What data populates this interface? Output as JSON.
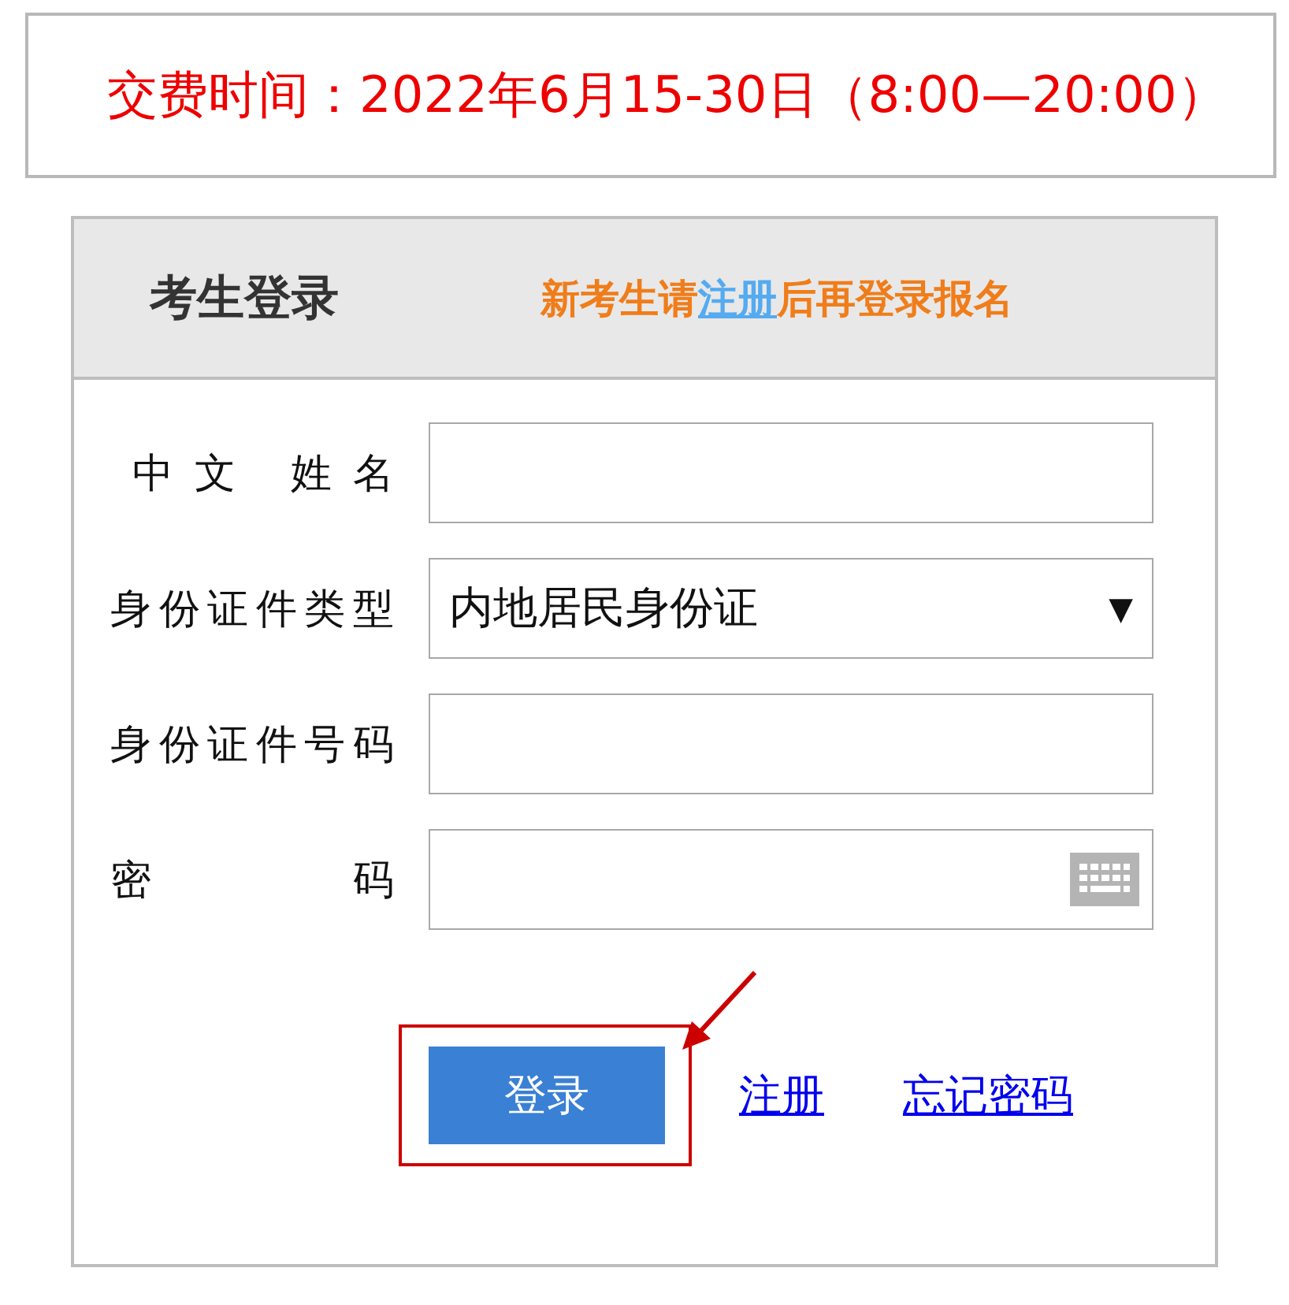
{
  "notice": {
    "text": "交费时间：2022年6月15-30日（8:00—20:00）"
  },
  "login": {
    "title": "考生登录",
    "hint": {
      "before": "新考生请",
      "link": "注册",
      "after": "后再登录报名"
    },
    "fields": [
      {
        "kind": "text",
        "label": "中文 姓名"
      },
      {
        "kind": "select",
        "label": "身份证件类型",
        "value": "内地居民身份证",
        "caret": "▼"
      },
      {
        "kind": "text",
        "label": "身份证件号码"
      },
      {
        "kind": "password",
        "label": "密 码"
      }
    ],
    "submit": {
      "label": "登录",
      "highlighted": true
    },
    "links": [
      "注册",
      "忘记密码"
    ]
  }
}
